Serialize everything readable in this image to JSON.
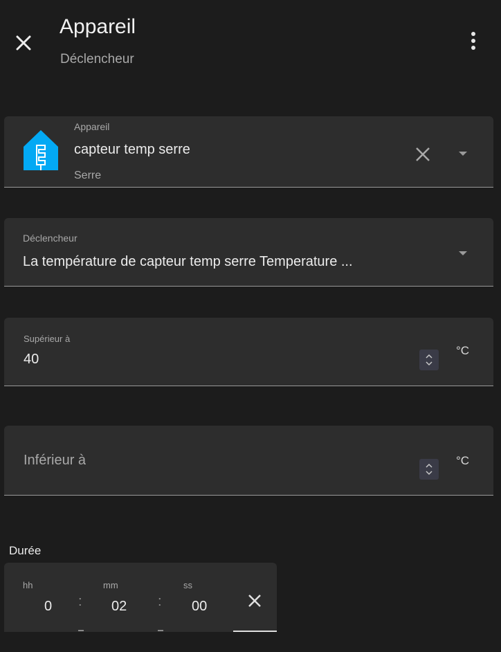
{
  "header": {
    "title": "Appareil",
    "subtitle": "Déclencheur"
  },
  "device_field": {
    "label": "Appareil",
    "value": "capteur temp serre",
    "area": "Serre",
    "icon": "home-assistant-logo-icon"
  },
  "trigger_field": {
    "label": "Déclencheur",
    "value": "La température de capteur temp serre Temperature ..."
  },
  "above_field": {
    "label": "Supérieur à",
    "value": "40",
    "unit": "°C"
  },
  "below_field": {
    "placeholder": "Inférieur à",
    "unit": "°C"
  },
  "duration": {
    "label": "Durée",
    "hh_label": "hh",
    "hh_value": "0",
    "mm_label": "mm",
    "mm_value": "02",
    "ss_label": "ss",
    "ss_value": "00",
    "separator": ":"
  },
  "colors": {
    "background": "#1c1c1c",
    "field_bg": "#2d2d2d",
    "accent_icon": "#03a9f4"
  }
}
